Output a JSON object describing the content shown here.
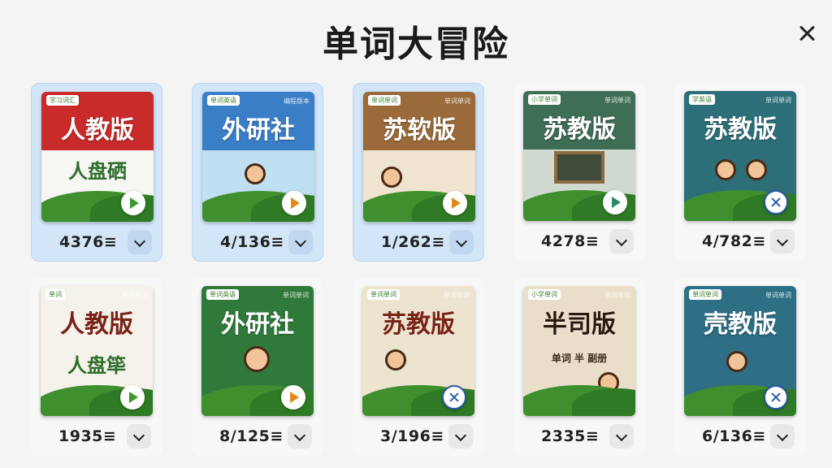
{
  "title": "单词大冒险",
  "close_label": "×",
  "books": [
    {
      "badge": "学习词汇",
      "corner": "",
      "title": "人教版",
      "subtitle": "人盘硒",
      "count": "4376≡",
      "action": "play",
      "selected": true,
      "top": "#c92a2a",
      "mid": "#f6f6f2",
      "title_dark": false
    },
    {
      "badge": "单词英语",
      "corner": "编程版本",
      "title": "外研社",
      "subtitle": "",
      "count": "4/136≡",
      "action": "play",
      "selected": true,
      "top": "#3a7ec8",
      "mid": "#bfe0f2",
      "title_dark": false
    },
    {
      "badge": "单词单词",
      "corner": "单词单词",
      "title": "苏软版",
      "subtitle": "",
      "count": "1/262≡",
      "action": "play",
      "selected": true,
      "top": "#9a6a3a",
      "mid": "#efe4cf",
      "title_dark": false
    },
    {
      "badge": "小学单词",
      "corner": "单词单词",
      "title": "苏教版",
      "subtitle": "",
      "count": "4278≡",
      "action": "play",
      "selected": false,
      "top": "#3f6e56",
      "mid": "#cfd9cf",
      "title_dark": false
    },
    {
      "badge": "学英语",
      "corner": "单词单词",
      "title": "苏教版",
      "subtitle": "",
      "count": "4/782≡",
      "action": "cancel",
      "selected": false,
      "top": "#2d6f78",
      "mid": "#2d6f78",
      "title_dark": false
    },
    {
      "badge": "单词",
      "corner": "单词单词",
      "title": "人教版",
      "subtitle": "人盘筚",
      "count": "1935≡",
      "action": "play",
      "selected": false,
      "top": "#f4f2ea",
      "mid": "#f4f2ea",
      "title_dark": true
    },
    {
      "badge": "单词英语",
      "corner": "单词单词",
      "title": "外研社",
      "subtitle": "",
      "count": "8/125≡",
      "action": "play",
      "selected": false,
      "top": "#2f7a3a",
      "mid": "#2f7a3a",
      "title_dark": false
    },
    {
      "badge": "单词单词",
      "corner": "单词单词",
      "title": "苏教版",
      "subtitle": "",
      "count": "3/196≡",
      "action": "cancel",
      "selected": false,
      "top": "#ece4cf",
      "mid": "#ece4cf",
      "title_dark": true
    },
    {
      "badge": "小学单词",
      "corner": "单词单词",
      "title": "半司版",
      "subtitle": "单词 半 副册",
      "count": "2335≡",
      "action": "play",
      "selected": false,
      "top": "#e9dfc8",
      "mid": "#e9dfc8",
      "title_dark": true
    },
    {
      "badge": "单词单词",
      "corner": "单词单词",
      "title": "壳教版",
      "subtitle": "",
      "count": "6/136≡",
      "action": "cancel",
      "selected": false,
      "top": "#2e6f86",
      "mid": "#2e6f86",
      "title_dark": false
    }
  ]
}
